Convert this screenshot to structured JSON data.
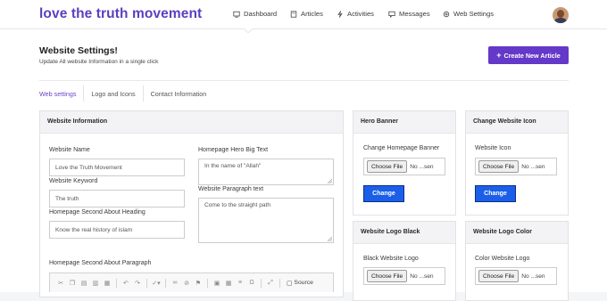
{
  "brand": "love the truth movement",
  "nav": [
    {
      "label": "Dashboard",
      "icon": "dashboard-icon"
    },
    {
      "label": "Articles",
      "icon": "articles-icon"
    },
    {
      "label": "Activities",
      "icon": "activities-icon"
    },
    {
      "label": "Messages",
      "icon": "messages-icon"
    },
    {
      "label": "Web Settings",
      "icon": "settings-icon"
    }
  ],
  "page": {
    "title": "Website Settings!",
    "subtitle": "Update All website Information in a single click",
    "create_button": "Create New Article"
  },
  "tabs": [
    "Web settings",
    "Logo and Icons",
    "Contact Information"
  ],
  "website_info": {
    "heading": "Website Information",
    "website_name_label": "Website Name",
    "website_name_value": "Love the Truth Movement",
    "website_keyword_label": "Website Keyword",
    "website_keyword_value": "The truth",
    "second_about_heading_label": "Homepage Second About Heading",
    "second_about_heading_value": "Know the real history of islam",
    "hero_big_text_label": "Homepage Hero Big Text",
    "hero_big_text_value": "In the name of \"Allah\"",
    "paragraph_text_label": "Website Paragraph text",
    "paragraph_text_value": "Come to the straight path",
    "second_about_paragraph_label": "Homepage Second About Paragraph",
    "editor_source_label": "Source"
  },
  "hero_banner": {
    "heading": "Hero Banner",
    "label": "Change Homepage Banner",
    "file_button": "Choose File",
    "file_status": "No ...sen",
    "change_button": "Change"
  },
  "change_icon": {
    "heading": "Change Website Icon",
    "label": "Website Icon",
    "file_button": "Choose File",
    "file_status": "No ...sen",
    "change_button": "Change"
  },
  "logo_black": {
    "heading": "Website Logo Black",
    "label": "Black Website Logo",
    "file_button": "Choose File",
    "file_status": "No ...sen"
  },
  "logo_color": {
    "heading": "Website Logo Color",
    "label": "Color Website Logo",
    "file_button": "Choose File",
    "file_status": "No ...sen"
  },
  "colors": {
    "brand": "#5a3fc0",
    "primary_button": "#6438c8",
    "change_button": "#1b5fe8",
    "active_tab": "#6a44c9"
  }
}
